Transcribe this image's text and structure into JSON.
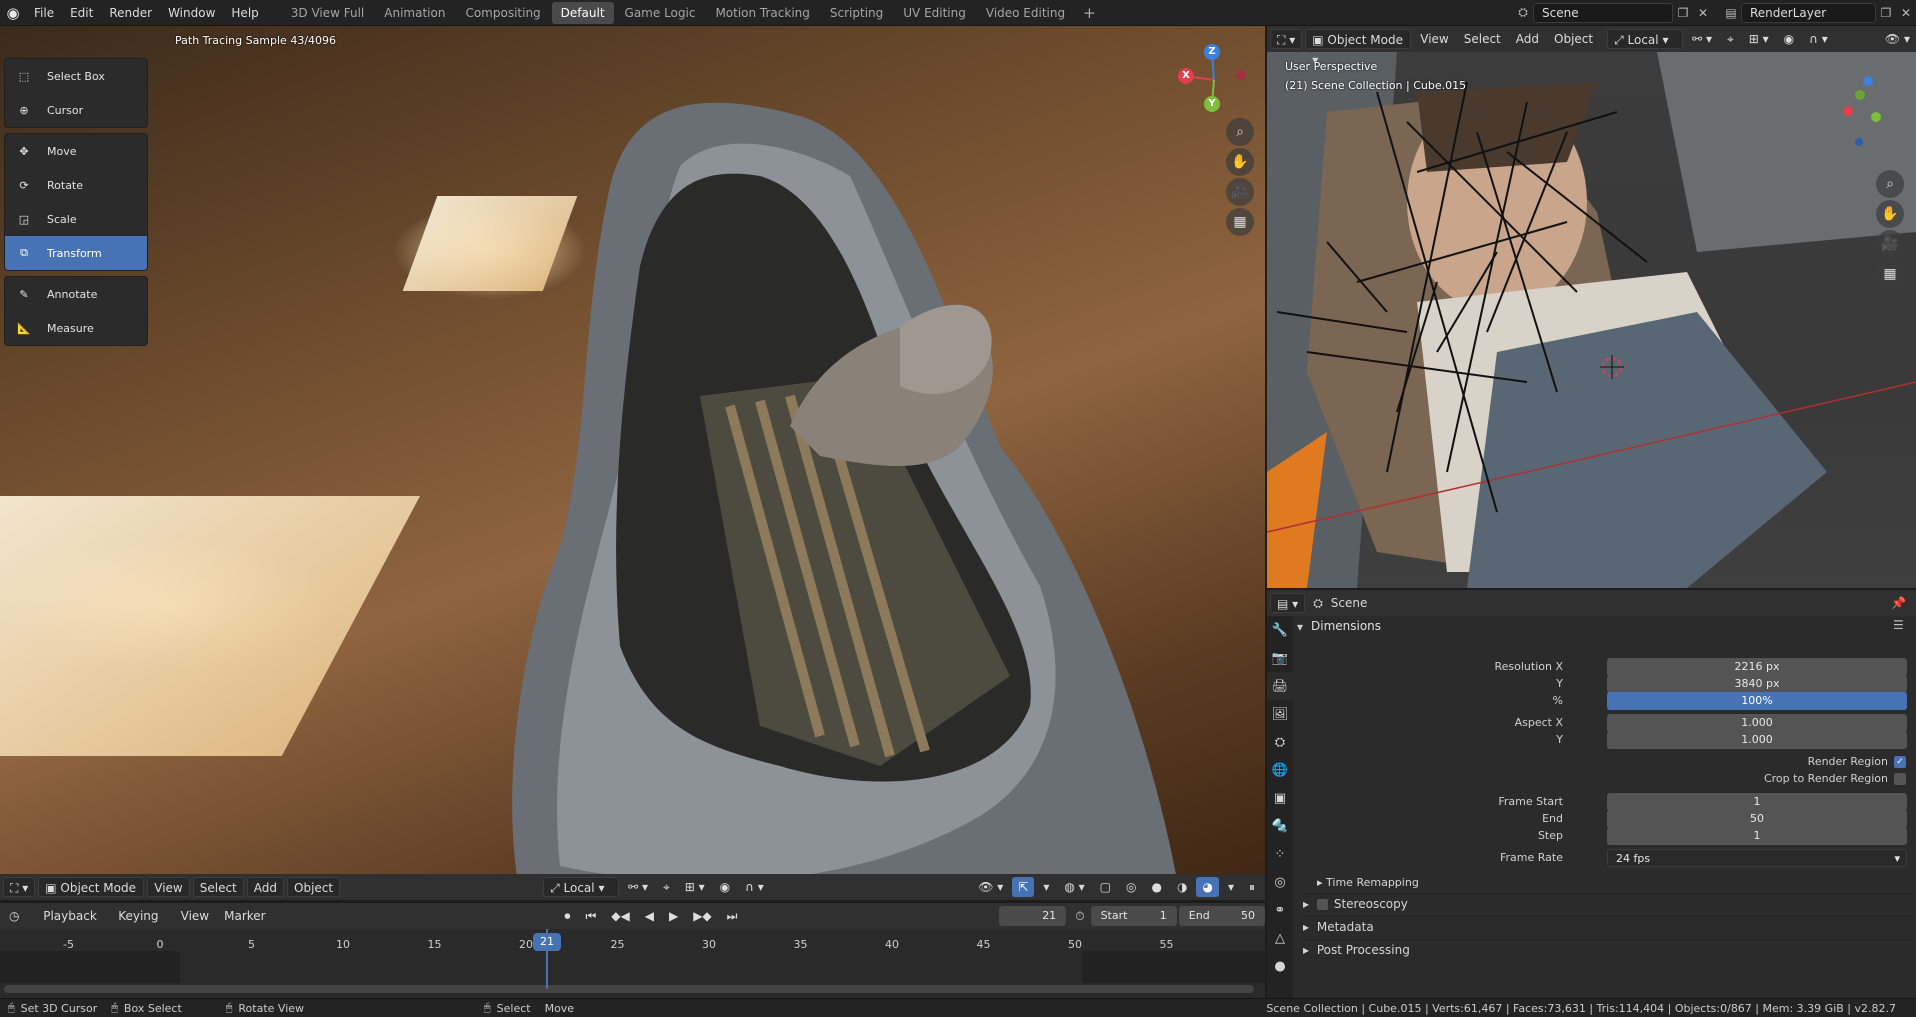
{
  "topbar": {
    "menus": [
      "File",
      "Edit",
      "Render",
      "Window",
      "Help"
    ],
    "workspaces": [
      "3D View Full",
      "Animation",
      "Compositing",
      "Default",
      "Game Logic",
      "Motion Tracking",
      "Scripting",
      "UV Editing",
      "Video Editing"
    ],
    "active_workspace": "Default",
    "scene": "Scene",
    "view_layer": "RenderLayer"
  },
  "left_viewport": {
    "overlay_text": "Path Tracing Sample 43/4096",
    "tools": [
      {
        "label": "Select Box",
        "icon": "select-box-icon"
      },
      {
        "label": "Cursor",
        "icon": "cursor-icon"
      },
      {
        "label": "Move",
        "icon": "move-icon"
      },
      {
        "label": "Rotate",
        "icon": "rotate-icon"
      },
      {
        "label": "Scale",
        "icon": "scale-icon"
      },
      {
        "label": "Transform",
        "icon": "transform-icon"
      },
      {
        "label": "Annotate",
        "icon": "annotate-icon"
      },
      {
        "label": "Measure",
        "icon": "measure-icon"
      }
    ],
    "active_tool": "Transform",
    "gizmo": {
      "x": "X",
      "y": "Y",
      "z": "Z"
    },
    "header": {
      "mode": "Object Mode",
      "menus": [
        "View",
        "Select",
        "Add",
        "Object"
      ],
      "orientation": "Local"
    }
  },
  "timeline": {
    "menus": [
      "Playback",
      "Keying",
      "View",
      "Marker"
    ],
    "current_frame": "21",
    "start_label": "Start",
    "start": "1",
    "end_label": "End",
    "end": "50",
    "ruler": [
      "-5",
      "0",
      "5",
      "10",
      "15",
      "20",
      "25",
      "30",
      "35",
      "40",
      "45",
      "50",
      "55"
    ],
    "playhead": "21"
  },
  "right_viewport": {
    "header": {
      "mode": "Object Mode",
      "menus": [
        "View",
        "Select",
        "Add",
        "Object"
      ],
      "orientation": "Local"
    },
    "perspective": "User Perspective",
    "collection": "(21) Scene Collection | Cube.015"
  },
  "properties": {
    "context": "Scene",
    "panel": "Dimensions",
    "resolution_x_label": "Resolution X",
    "resolution_x": "2216 px",
    "resolution_y_label": "Y",
    "resolution_y": "3840 px",
    "percent_label": "%",
    "percent": "100%",
    "aspect_x_label": "Aspect X",
    "aspect_x": "1.000",
    "aspect_y_label": "Y",
    "aspect_y": "1.000",
    "render_region": "Render Region",
    "crop_region": "Crop to Render Region",
    "frame_start_label": "Frame Start",
    "frame_start": "1",
    "frame_end_label": "End",
    "frame_end": "50",
    "frame_step_label": "Step",
    "frame_step": "1",
    "frame_rate_label": "Frame Rate",
    "frame_rate": "24 fps",
    "subpanels": [
      "Time Remapping",
      "Stereoscopy",
      "Metadata",
      "Post Processing"
    ]
  },
  "statusbar": {
    "hints": [
      "Set 3D Cursor",
      "Box Select",
      "Rotate View",
      "Select",
      "Move"
    ],
    "stats": "Scene Collection | Cube.015 | Verts:61,467 | Faces:73,631 | Tris:114,404 | Objects:0/867 | Mem: 3.39 GiB | v2.82.7"
  },
  "colors": {
    "accent": "#4772b3",
    "bg": "#303030",
    "x_axis": "#e04050",
    "y_axis": "#7cbf3a",
    "z_axis": "#3a82e0"
  }
}
